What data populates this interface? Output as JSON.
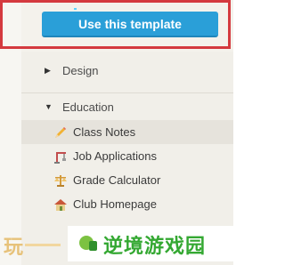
{
  "toolbar": {
    "use_template_label": "Use this template"
  },
  "nav": {
    "categories": [
      {
        "label": "Design",
        "expanded": false
      },
      {
        "label": "Education",
        "expanded": true
      }
    ],
    "education_items": [
      {
        "label": "Class Notes",
        "icon": "pencil-icon",
        "active": true
      },
      {
        "label": "Job Applications",
        "icon": "crane-icon",
        "active": false
      },
      {
        "label": "Grade Calculator",
        "icon": "scale-icon",
        "active": false
      },
      {
        "label": "Club Homepage",
        "icon": "house-icon",
        "active": false
      }
    ]
  },
  "watermark": {
    "left_text": "玩",
    "brand_text": "逆境游戏园"
  },
  "colors": {
    "accent": "#2a9fd8",
    "highlight_frame": "#d43a3f",
    "brand_green": "#34a832"
  }
}
